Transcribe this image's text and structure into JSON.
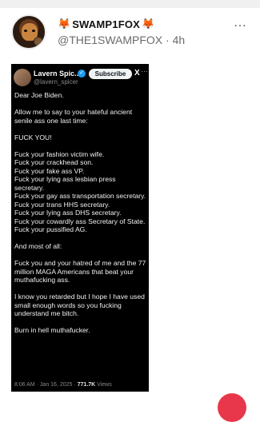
{
  "post": {
    "fox_emoji": "🦊",
    "display_name": "SWAMP1FOX",
    "handle": "@THE1SWAMPFOX",
    "separator": "·",
    "time": "4h",
    "more_icon": "⋯"
  },
  "screenshot": {
    "name": "Lavern Spic...",
    "handle": "@lavern_spicer",
    "subscribe_label": "Subscribe",
    "verified_icon": "✓",
    "x_logo": "X",
    "more_icon": "···",
    "paragraphs": [
      "Dear Joe Biden.",
      "Allow me to say to your hateful ancient senile ass one last time:",
      "FUCK YOU!",
      "Fuck your fashion victim wife.\nFuck your crackhead son.\nFuck your fake ass VP.\nFuck your lying ass lesbian press secretary.\nFuck your gay ass transportation secretary.\nFuck your trans HHS secretary.\nFuck your lying ass DHS secretary.\nFuck your cowardly ass Secretary of State.\nFuck your pussified AG.",
      "And most of all:",
      "Fuck you and your hatred of me and the 77 million MAGA Americans that beat your muthafucking ass.",
      "I know you retarded but I hope I have used small enough words so you fucking understand me bitch.",
      "Burn in hell muthafucker."
    ],
    "footer": {
      "time": "8:06 AM",
      "date": "Jan 16, 2025",
      "views_count": "771.7K",
      "views_label": "Views"
    }
  }
}
